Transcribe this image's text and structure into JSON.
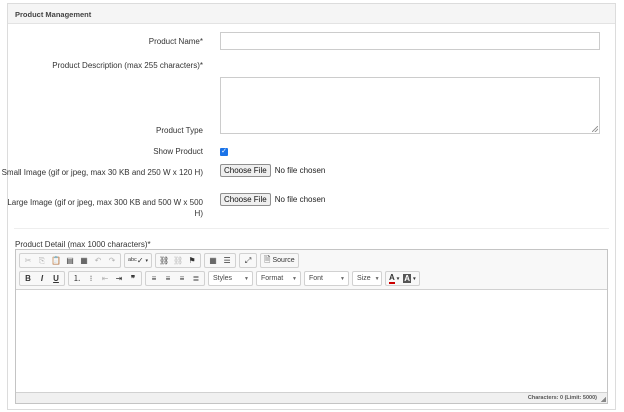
{
  "panel": {
    "title": "Product Management"
  },
  "form": {
    "product_name_label": "Product Name*",
    "product_name_value": "",
    "description_label": "Product Description (max 255 characters)*",
    "description_value": "",
    "product_type_label": "Product Type",
    "show_product_label": "Show Product",
    "show_product_checked": true,
    "small_image_label": "Small Image (gif or jpeg, max 30 KB and 250 W x 120 H)",
    "large_image_label": "Large Image (gif or jpeg, max 300 KB and 500 W x 500 H)",
    "choose_file_label": "Choose File",
    "no_file_text": "No file chosen"
  },
  "detail": {
    "label": "Product Detail (max 1000 characters)*",
    "source_label": "Source",
    "combos": {
      "styles": "Styles",
      "format": "Format",
      "font": "Font",
      "size": "Size"
    },
    "status": "Characters: 0 (Limit: 5000)"
  },
  "toolbar_icons": {
    "row1": [
      "cut-icon",
      "copy-icon",
      "paste-icon",
      "paste-text-icon",
      "paste-word-icon",
      "undo-icon",
      "redo-icon",
      "spellcheck-icon",
      "link-icon",
      "unlink-icon",
      "anchor-icon",
      "table-icon",
      "horizontal-line-icon",
      "maximize-icon",
      "source-icon"
    ],
    "row2": [
      "bold-icon",
      "italic-icon",
      "underline-icon",
      "numbered-list-icon",
      "bulleted-list-icon",
      "outdent-icon",
      "indent-icon",
      "blockquote-icon",
      "align-left-icon",
      "align-center-icon",
      "align-right-icon",
      "justify-icon",
      "text-color-icon",
      "background-color-icon"
    ]
  },
  "colors": {
    "accent": "#1a73e8",
    "border": "#cccccc",
    "toolbar_bg": "#f8f8f8"
  }
}
